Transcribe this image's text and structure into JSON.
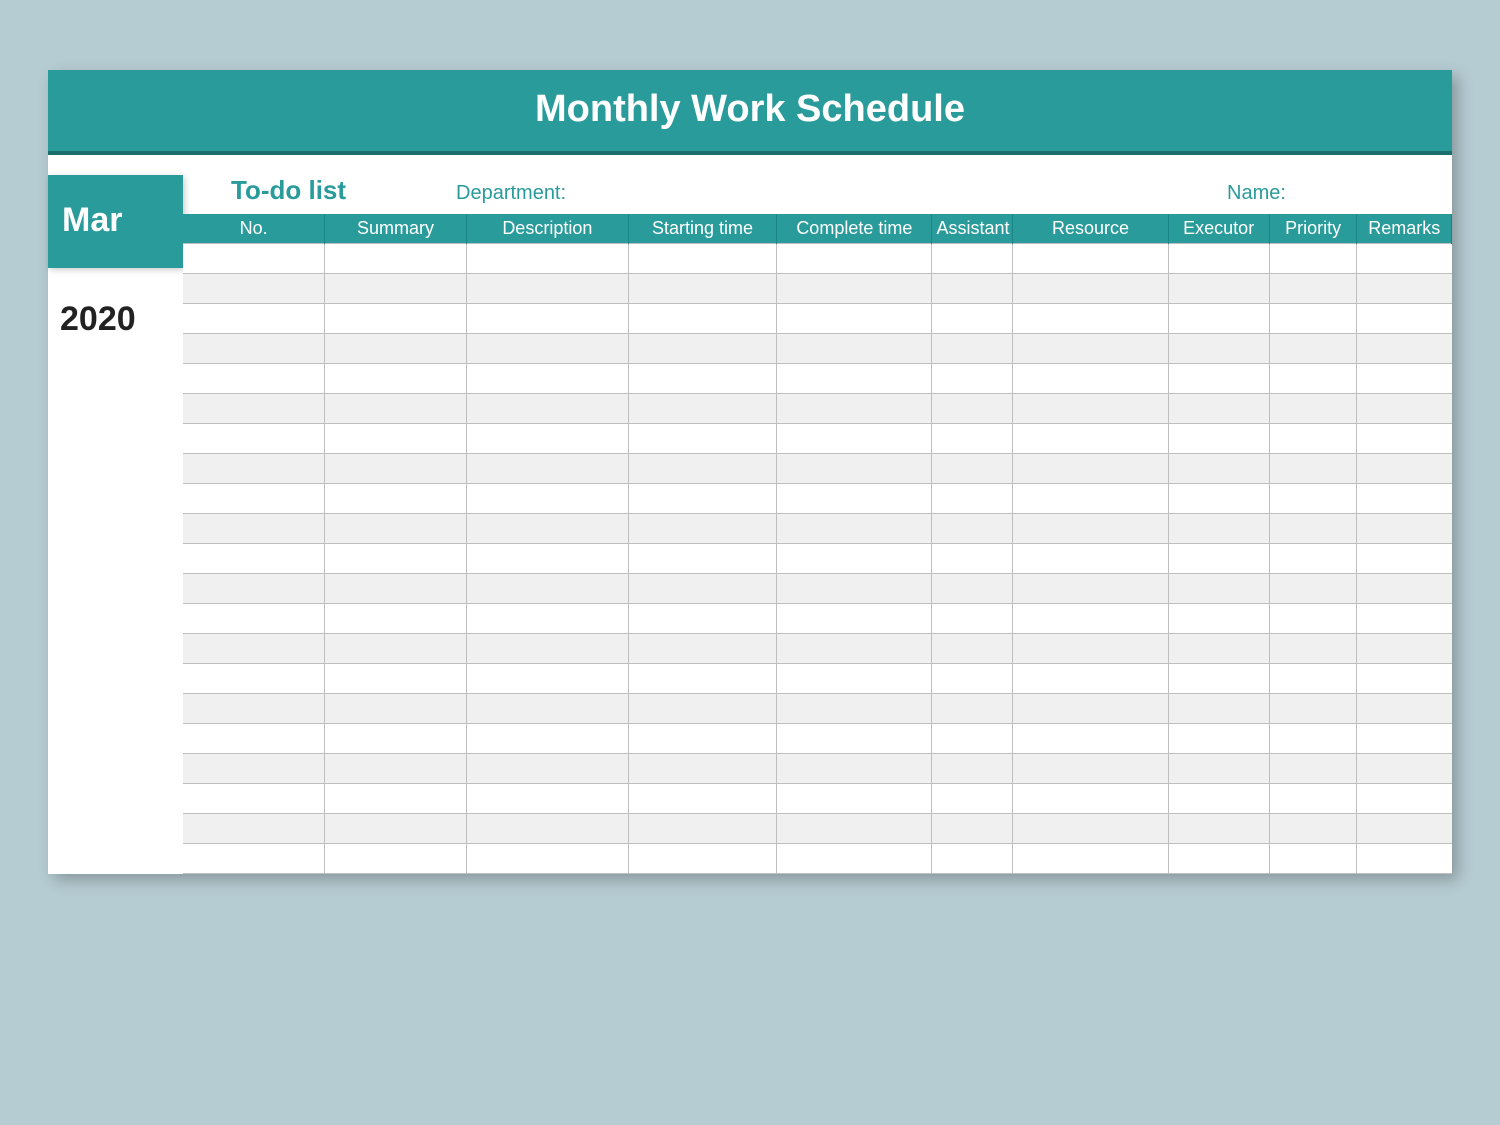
{
  "header": {
    "title": "Monthly Work Schedule"
  },
  "side": {
    "month": "Mar",
    "year": "2020"
  },
  "info": {
    "todo": "To-do list",
    "department": "Department:",
    "name": "Name:"
  },
  "columns": [
    "No.",
    "Summary",
    "Description",
    "Starting time",
    "Complete time",
    "Assistant",
    "Resource",
    "Executor",
    "Priority",
    "Remarks"
  ],
  "row_count": 21,
  "colors": {
    "accent": "#2a9b9b",
    "page_bg": "#b5ccd2",
    "shade": "#f0f0f0"
  }
}
